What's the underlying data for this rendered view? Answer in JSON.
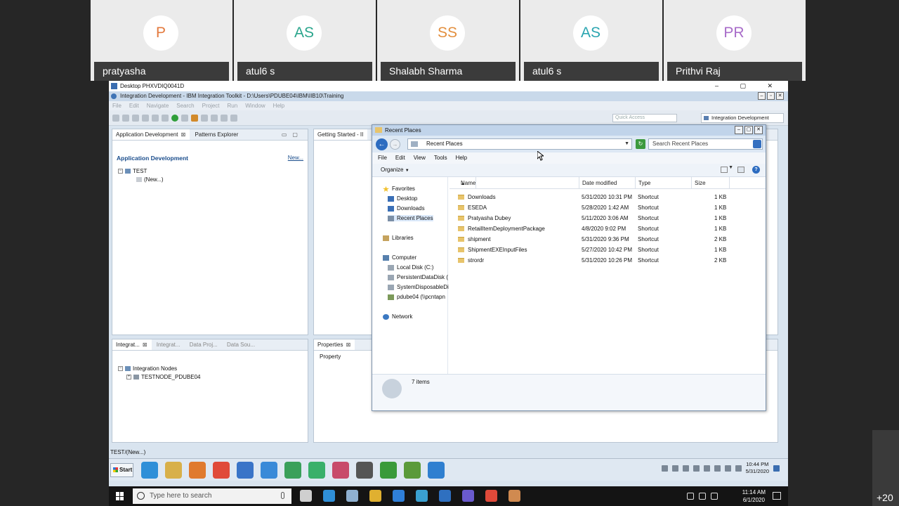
{
  "participants": [
    {
      "initials": "P",
      "name": "pratyasha",
      "color": "#e37a3e"
    },
    {
      "initials": "AS",
      "name": "atul6 s",
      "color": "#2aa58c"
    },
    {
      "initials": "SS",
      "name": "Shalabh Sharma",
      "color": "#e38f3e"
    },
    {
      "initials": "AS",
      "name": "atul6 s",
      "color": "#2aa5b0"
    },
    {
      "initials": "PR",
      "name": "Prithvi Raj",
      "color": "#a86cc9"
    }
  ],
  "overflow_count": "+20",
  "remote": {
    "title": "Desktop PHXVDIQ0041D",
    "controls": "–  ▢  ✕"
  },
  "eclipse": {
    "title": "Integration Development - IBM Integration Toolkit - D:\\Users\\PDUBE04\\IBM\\IIB10\\Training",
    "menu": [
      "File",
      "Edit",
      "Navigate",
      "Search",
      "Project",
      "Run",
      "Window",
      "Help"
    ],
    "quick_access": "Quick Access",
    "perspective": "Integration Development",
    "app_dev_tabs": {
      "tab1": "Application Development",
      "tab2": "Patterns Explorer"
    },
    "app_dev_heading": "Application Development",
    "new_link": "New...",
    "tree": {
      "project": "TEST",
      "child": "(New...)"
    },
    "getting_started_tab": "Getting Started - II",
    "bottom_tabs": {
      "t1": "Integrat...",
      "t2": "Integrat...",
      "t3": "Data Proj...",
      "t4": "Data Sou..."
    },
    "nodes_root": "Integration Nodes",
    "node": "TESTNODE_PDUBE04",
    "properties_tab": "Properties",
    "property_col": "Property",
    "status": "TEST/(New...)"
  },
  "explorer": {
    "title": "Recent Places",
    "address": "Recent Places",
    "search_placeholder": "Search Recent Places",
    "menu": [
      "File",
      "Edit",
      "View",
      "Tools",
      "Help"
    ],
    "organize": "Organize",
    "nav": {
      "favorites": "Favorites",
      "desktop": "Desktop",
      "downloads": "Downloads",
      "recent": "Recent Places",
      "libraries": "Libraries",
      "computer": "Computer",
      "local_disk": "Local Disk (C:)",
      "persistent": "PersistentDataDisk (",
      "system": "SystemDisposableDi",
      "pdube": "pdube04 (\\\\pcntapn",
      "network": "Network"
    },
    "columns": {
      "name": "Name",
      "date": "Date modified",
      "type": "Type",
      "size": "Size"
    },
    "rows": [
      {
        "name": "Downloads",
        "date": "5/31/2020 10:31 PM",
        "type": "Shortcut",
        "size": "1 KB"
      },
      {
        "name": "ESEDA",
        "date": "5/28/2020 1:42 AM",
        "type": "Shortcut",
        "size": "1 KB"
      },
      {
        "name": "Pratyasha Dubey",
        "date": "5/11/2020 3:06 AM",
        "type": "Shortcut",
        "size": "1 KB"
      },
      {
        "name": "RetailItemDeploymentPackage",
        "date": "4/8/2020 9:02 PM",
        "type": "Shortcut",
        "size": "1 KB"
      },
      {
        "name": "shipment",
        "date": "5/31/2020 9:36 PM",
        "type": "Shortcut",
        "size": "2 KB"
      },
      {
        "name": "ShipmentEXEInputFiles",
        "date": "5/27/2020 10:42 PM",
        "type": "Shortcut",
        "size": "1 KB"
      },
      {
        "name": "strordr",
        "date": "5/31/2020 10:26 PM",
        "type": "Shortcut",
        "size": "2 KB"
      }
    ],
    "item_count": "7 items"
  },
  "remote_taskbar": {
    "start": "Start",
    "time": "10:44 PM",
    "date": "5/31/2020",
    "apps": [
      "#2f8fd8",
      "#d8b04a",
      "#e07a2e",
      "#e04a3a",
      "#3a74c8",
      "#3a8ad8",
      "#3aa05a",
      "#3ab06a",
      "#c84a6a",
      "#555555",
      "#3a9a3a",
      "#5a9a3a",
      "#2f7fd0"
    ]
  },
  "win_taskbar": {
    "search_placeholder": "Type here to search",
    "time": "11:14 AM",
    "date": "6/1/2020",
    "apps": [
      "#cfcfcf",
      "#2f8fd8",
      "#8fb0d0",
      "#e0b030",
      "#2f7fd8",
      "#3aa0d0",
      "#2f70c0",
      "#6a5acd",
      "#e04a3a",
      "#d08a50"
    ]
  }
}
